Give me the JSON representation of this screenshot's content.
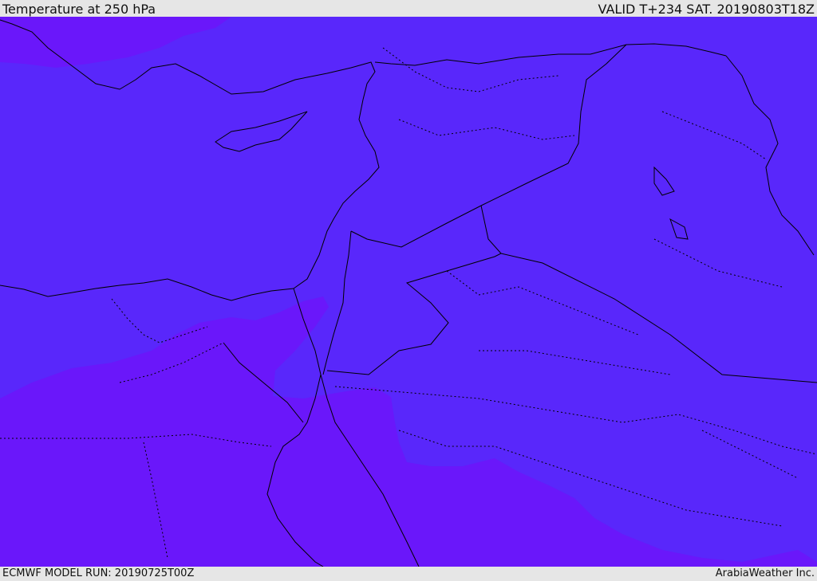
{
  "header": {
    "title": "Temperature at 250 hPa",
    "valid": "VALID T+234 SAT. 20190803T18Z"
  },
  "footer": {
    "model_run": "ECMWF MODEL RUN: 20190725T00Z",
    "credit": "ArabiaWeather Inc."
  },
  "map": {
    "variable": "Temperature",
    "level": "250 hPa",
    "colors": {
      "cold_band": "#6a17fa",
      "mid_band": "#5927fb",
      "border_line": "#000000"
    }
  }
}
